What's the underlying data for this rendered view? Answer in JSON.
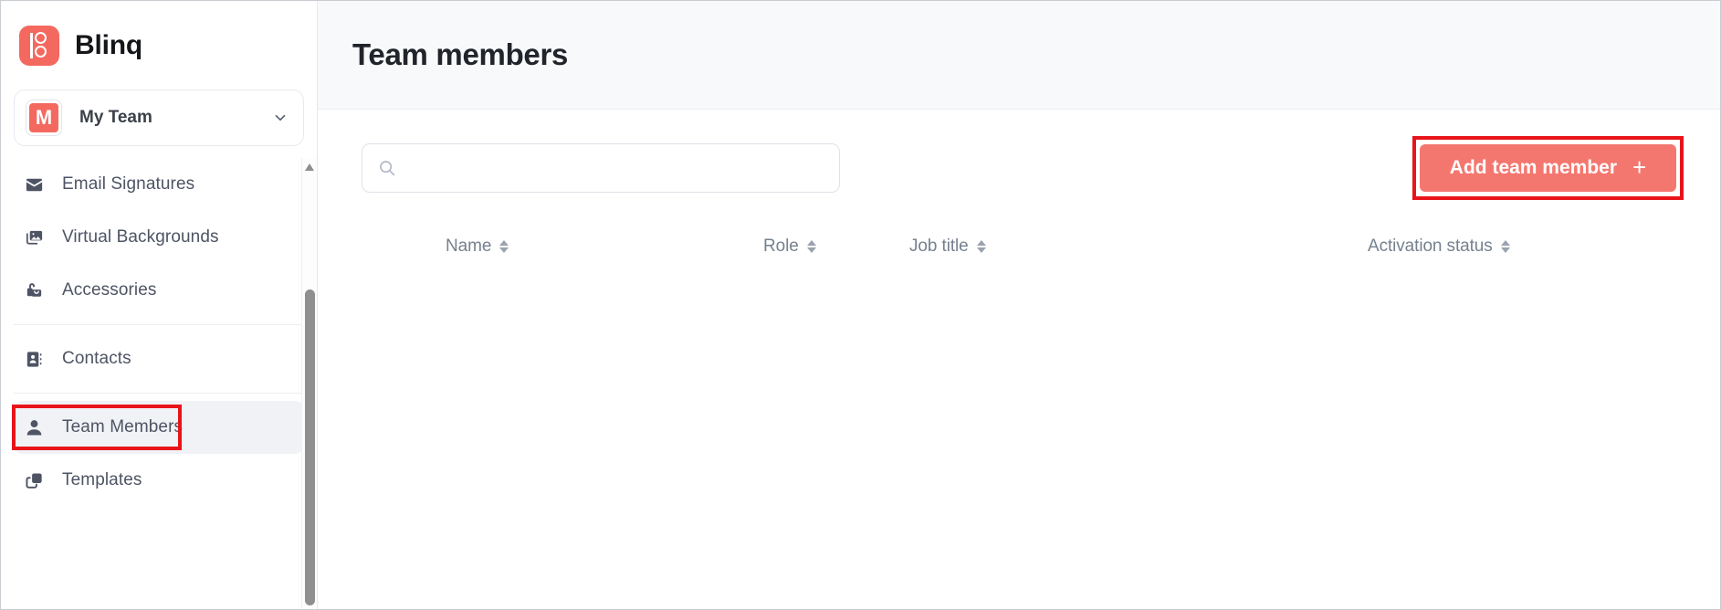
{
  "brand": {
    "name": "Blinq",
    "logo_icon": "blinq-logo-icon",
    "logo_color": "#f4695f"
  },
  "team_switcher": {
    "avatar_initial": "M",
    "team_name": "My Team",
    "chevron_icon": "chevron-down-icon",
    "avatar_color": "#f4695f"
  },
  "sidebar": {
    "groups": [
      {
        "items": [
          {
            "label": "Email Signatures",
            "icon": "envelope-icon",
            "active": false
          },
          {
            "label": "Virtual Backgrounds",
            "icon": "image-icon",
            "active": false
          },
          {
            "label": "Accessories",
            "icon": "bag-icon",
            "active": false
          }
        ]
      },
      {
        "items": [
          {
            "label": "Contacts",
            "icon": "address-book-icon",
            "active": false
          }
        ]
      },
      {
        "items": [
          {
            "label": "Team Members",
            "icon": "person-icon",
            "active": true,
            "highlighted": true
          },
          {
            "label": "Templates",
            "icon": "copy-icon",
            "active": false
          }
        ]
      }
    ],
    "scrollbar": {
      "up_arrow_icon": "scroll-up-arrow-icon",
      "thumb_icon": "scrollbar-thumb"
    }
  },
  "header": {
    "title": "Team members"
  },
  "search": {
    "icon": "search-icon",
    "value": "",
    "placeholder": ""
  },
  "add_button": {
    "label": "Add team member",
    "plus_icon": "plus-icon",
    "color": "#f4776f",
    "highlight_color": "#e8141a"
  },
  "table": {
    "columns": [
      {
        "label": "Name",
        "sort_icon": "sort-icon"
      },
      {
        "label": "Role",
        "sort_icon": "sort-icon"
      },
      {
        "label": "Job title",
        "sort_icon": "sort-icon"
      },
      {
        "label": "Activation status",
        "sort_icon": "sort-icon"
      }
    ],
    "rows": []
  }
}
